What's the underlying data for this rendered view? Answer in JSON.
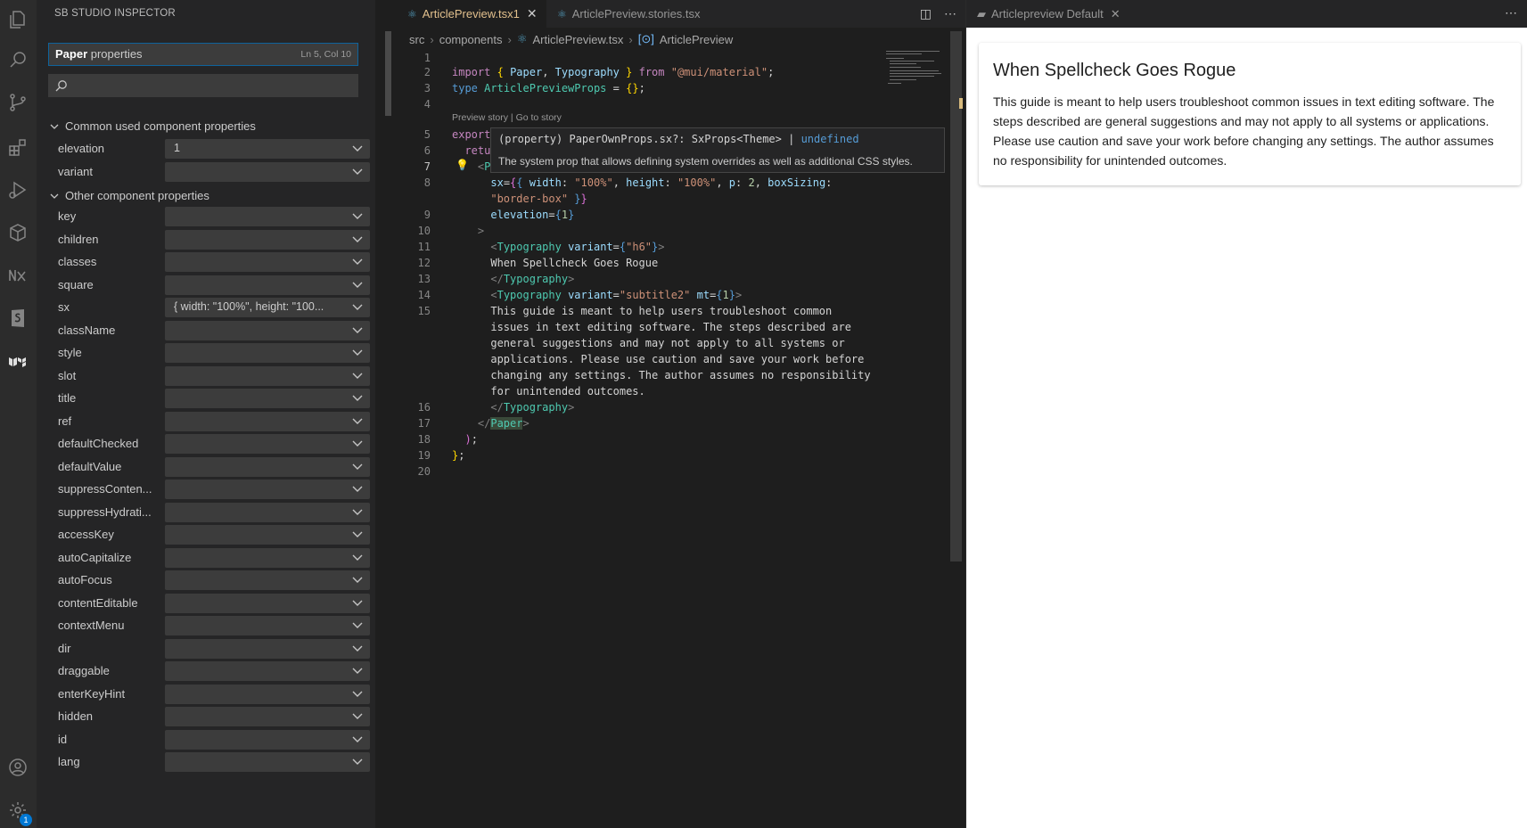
{
  "activity_bar": {
    "icons": [
      "explorer-icon",
      "search-icon",
      "source-control-icon",
      "extensions-icon",
      "run-debug-icon",
      "package-icon",
      "nx-icon",
      "storybook-icon",
      "mui-icon"
    ],
    "bottom_badge": "1"
  },
  "sidebar": {
    "title": "SB STUDIO INSPECTOR",
    "header_bold": "Paper",
    "header_rest": " properties",
    "cursor_pos": "Ln 5, Col 10",
    "search_placeholder": "",
    "section_common": "Common used component properties",
    "section_other": "Other component properties",
    "common_props": [
      {
        "label": "elevation",
        "value": "1"
      },
      {
        "label": "variant",
        "value": ""
      }
    ],
    "other_props": [
      {
        "label": "key",
        "value": ""
      },
      {
        "label": "children",
        "value": ""
      },
      {
        "label": "classes",
        "value": ""
      },
      {
        "label": "square",
        "value": ""
      },
      {
        "label": "sx",
        "value": "{ width: \"100%\", height: \"100..."
      },
      {
        "label": "className",
        "value": ""
      },
      {
        "label": "style",
        "value": ""
      },
      {
        "label": "slot",
        "value": ""
      },
      {
        "label": "title",
        "value": ""
      },
      {
        "label": "ref",
        "value": ""
      },
      {
        "label": "defaultChecked",
        "value": ""
      },
      {
        "label": "defaultValue",
        "value": ""
      },
      {
        "label": "suppressConten...",
        "value": ""
      },
      {
        "label": "suppressHydrati...",
        "value": ""
      },
      {
        "label": "accessKey",
        "value": ""
      },
      {
        "label": "autoCapitalize",
        "value": ""
      },
      {
        "label": "autoFocus",
        "value": ""
      },
      {
        "label": "contentEditable",
        "value": ""
      },
      {
        "label": "contextMenu",
        "value": ""
      },
      {
        "label": "dir",
        "value": ""
      },
      {
        "label": "draggable",
        "value": ""
      },
      {
        "label": "enterKeyHint",
        "value": ""
      },
      {
        "label": "hidden",
        "value": ""
      },
      {
        "label": "id",
        "value": ""
      },
      {
        "label": "lang",
        "value": ""
      }
    ]
  },
  "editor": {
    "tabs": [
      {
        "label": "ArticlePreview.tsx",
        "suffix": " 1",
        "active": true
      },
      {
        "label": "ArticlePreview.stories.tsx",
        "suffix": "",
        "active": false
      }
    ],
    "breadcrumb": [
      "src",
      "components",
      "ArticlePreview.tsx",
      "ArticlePreview"
    ],
    "codelens": "Preview story | Go to story",
    "line_numbers": [
      "1",
      "2",
      "3",
      "4",
      "5",
      "6",
      "7",
      "8",
      "9",
      "10",
      "11",
      "12",
      "13",
      "14",
      "15",
      "16",
      "17",
      "18",
      "19",
      "20"
    ],
    "hover": {
      "signature_pre": "(property) PaperOwnProps.sx?: SxProps<Theme> | ",
      "signature_post": "undefined",
      "doc": "The system prop that allows defining system overrides as well as additional CSS styles."
    }
  },
  "preview": {
    "tab_label": "Articlepreview Default",
    "heading": "When Spellcheck Goes Rogue",
    "body": "This guide is meant to help users troubleshoot common issues in text editing software. The steps described are general suggestions and may not apply to all systems or applications. Please use caution and save your work before changing any settings. The author assumes no responsibility for unintended outcomes."
  },
  "colors": {
    "accent": "#0078d4",
    "active_tab_text": "#e2c08d",
    "sidebar_bg": "#252526",
    "editor_bg": "#1e1e1e"
  }
}
